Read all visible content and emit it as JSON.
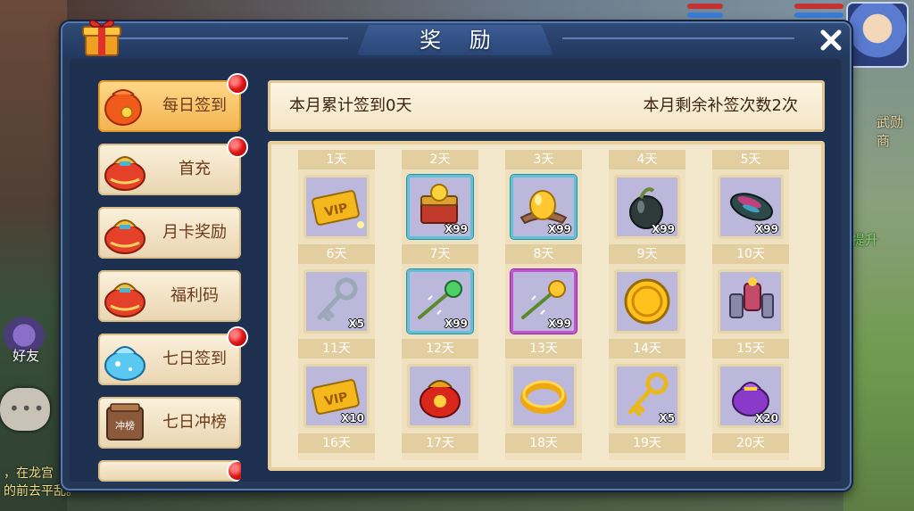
{
  "dialog": {
    "title": "奖 励",
    "close_icon": "close-icon"
  },
  "tabs": [
    {
      "label": "每日签到",
      "icon": "red-pouch-icon",
      "active": true,
      "badge": true
    },
    {
      "label": "首充",
      "icon": "money-bag-icon",
      "active": false,
      "badge": true
    },
    {
      "label": "月卡奖励",
      "icon": "money-bag-icon",
      "active": false,
      "badge": false
    },
    {
      "label": "福利码",
      "icon": "money-bag-icon",
      "active": false,
      "badge": false
    },
    {
      "label": "七日签到",
      "icon": "crystal-bag-icon",
      "active": false,
      "badge": true
    },
    {
      "label": "七日冲榜",
      "icon": "ranking-icon",
      "active": false,
      "badge": false,
      "icon_text": "冲榜"
    }
  ],
  "signin": {
    "monthly_total": "本月累计签到0天",
    "remaining_makeups": "本月剩余补签次数2次"
  },
  "days": [
    {
      "label": "1天",
      "item": "vip-card-icon",
      "qty": "",
      "frame": "plain"
    },
    {
      "label": "2天",
      "item": "treasure-box-icon",
      "qty": "X99",
      "frame": "blue"
    },
    {
      "label": "3天",
      "item": "golden-egg-icon",
      "qty": "X99",
      "frame": "blue"
    },
    {
      "label": "4天",
      "item": "dark-gourd-icon",
      "qty": "X99",
      "frame": "plain"
    },
    {
      "label": "5天",
      "item": "rainbow-stone-icon",
      "qty": "X99",
      "frame": "plain"
    },
    {
      "label": "6天",
      "item": "silver-key-icon",
      "qty": "X5",
      "frame": "plain"
    },
    {
      "label": "7天",
      "item": "green-staff-icon",
      "qty": "X99",
      "frame": "blue"
    },
    {
      "label": "8天",
      "item": "gold-staff-icon",
      "qty": "X99",
      "frame": "purple"
    },
    {
      "label": "9天",
      "item": "gold-coin-icon",
      "qty": "",
      "frame": "plain"
    },
    {
      "label": "10天",
      "item": "armor-set-icon",
      "qty": "",
      "frame": "plain"
    },
    {
      "label": "11天",
      "item": "vip-card-icon",
      "qty": "X10",
      "frame": "plain"
    },
    {
      "label": "12天",
      "item": "red-lucky-bag-icon",
      "qty": "",
      "frame": "plain"
    },
    {
      "label": "13天",
      "item": "gold-ring-icon",
      "qty": "",
      "frame": "plain"
    },
    {
      "label": "14天",
      "item": "gold-key-icon",
      "qty": "X5",
      "frame": "plain"
    },
    {
      "label": "15天",
      "item": "purple-pouch-icon",
      "qty": "X20",
      "frame": "plain"
    },
    {
      "label": "16天"
    },
    {
      "label": "17天"
    },
    {
      "label": "18天"
    },
    {
      "label": "19天"
    },
    {
      "label": "20天"
    }
  ],
  "background": {
    "right_text_1": "武勋商",
    "right_text_2": "提升",
    "friend_label": "好友",
    "chat_line_1": "，在龙宫",
    "chat_line_2": "的前去平乱。"
  }
}
